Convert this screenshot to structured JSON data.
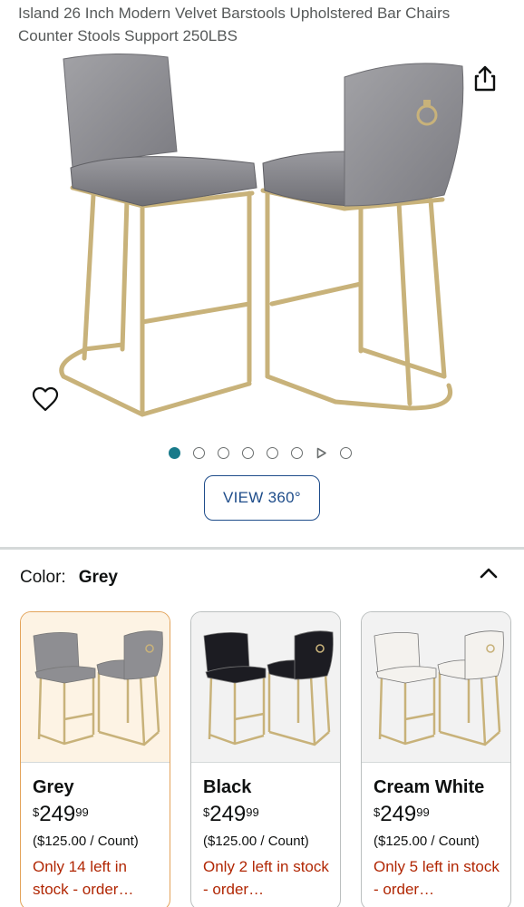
{
  "product": {
    "title": "Island 26 Inch Modern Velvet Barstools Upholstered Bar Chairs Counter Stools Support 250LBS"
  },
  "gallery": {
    "image_count": 7,
    "active_index": 0,
    "video_index": 6,
    "view360_label": "VIEW 360°"
  },
  "icons": {
    "share": "share-icon",
    "wishlist": "heart-icon",
    "collapse": "chevron-up-icon"
  },
  "colors": {
    "accent_teal": "#187a8a",
    "link_blue": "#1e4c8a",
    "stock_red": "#b12704",
    "selected_border": "#e3a35a"
  },
  "variation": {
    "label": "Color:",
    "selected": "Grey",
    "options": [
      {
        "name": "Grey",
        "price_currency": "$",
        "price_whole": "249",
        "price_fraction": "99",
        "unit_price": "($125.00 / Count)",
        "stock": "Only 14 left in stock - order…",
        "seat_color": "#8e8e92",
        "selected": true
      },
      {
        "name": "Black",
        "price_currency": "$",
        "price_whole": "249",
        "price_fraction": "99",
        "unit_price": "($125.00 / Count)",
        "stock": "Only 2 left in stock - order…",
        "seat_color": "#1c1c22",
        "selected": false
      },
      {
        "name": "Cream White",
        "price_currency": "$",
        "price_whole": "249",
        "price_fraction": "99",
        "unit_price": "($125.00 / Count)",
        "stock": "Only 5 left in stock - order…",
        "seat_color": "#f4f2ee",
        "selected": false
      }
    ]
  }
}
